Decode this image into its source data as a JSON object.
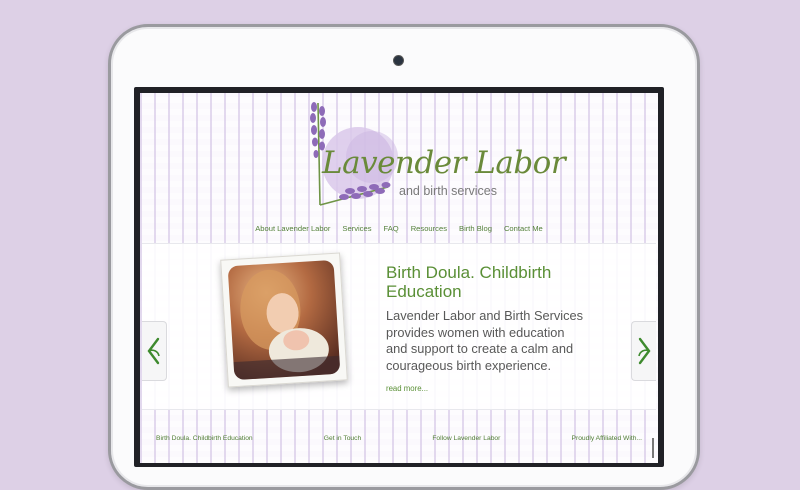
{
  "colors": {
    "background": "#ddd0e6",
    "accent_green": "#5a8f36",
    "lavender": "#8e6bb8"
  },
  "logo": {
    "title": "Lavender Labor",
    "subtitle": "and birth services"
  },
  "nav": {
    "items": [
      "About Lavender Labor",
      "Services",
      "FAQ",
      "Resources",
      "Birth Blog",
      "Contact Me"
    ]
  },
  "slide": {
    "title": "Birth Doula. Childbirth Education",
    "body": "Lavender Labor and Birth Services provides women with education and support to create a calm and courageous birth experience.",
    "read_more": "read more...",
    "prev_icon": "chevron-left-icon",
    "next_icon": "chevron-right-icon"
  },
  "footer": {
    "headings": [
      "Birth Doula. Childbirth Education",
      "Get in Touch",
      "Follow Lavender Labor",
      "Proudly Affiliated With..."
    ]
  }
}
